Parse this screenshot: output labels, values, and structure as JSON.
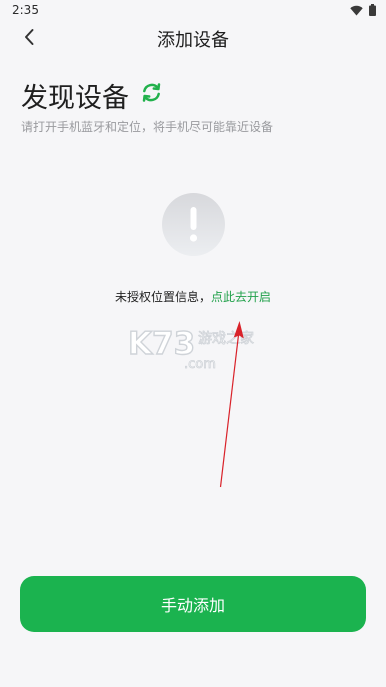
{
  "status_bar": {
    "time": "2:35"
  },
  "nav": {
    "title": "添加设备"
  },
  "discover": {
    "title": "发现设备",
    "hint": "请打开手机蓝牙和定位，将手机尽可能靠近设备"
  },
  "warning": {
    "message": "未授权位置信息，",
    "link": "点此去开启"
  },
  "watermark": {
    "brand": "K73",
    "site": "游戏之家",
    "domain": ".com"
  },
  "primary_button": {
    "label": "手动添加"
  },
  "colors": {
    "accent": "#1bb34f",
    "link": "#22a14b",
    "arrow": "#d9222a"
  }
}
